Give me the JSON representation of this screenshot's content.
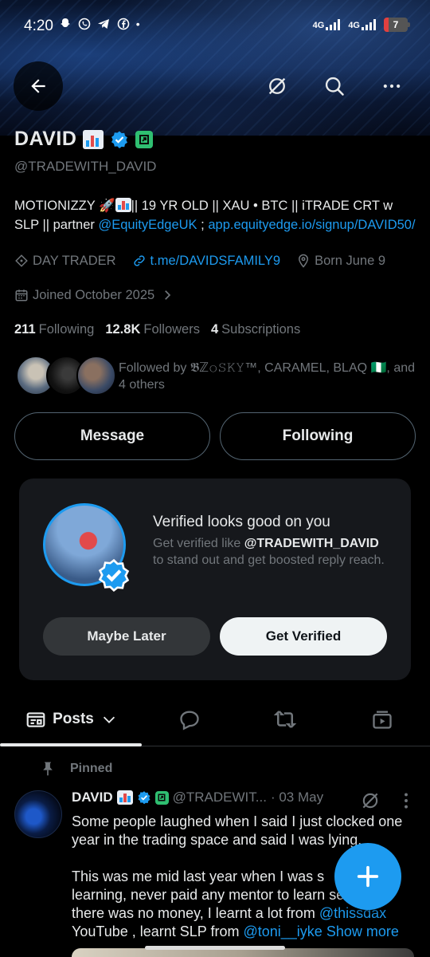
{
  "status_bar": {
    "time": "4:20",
    "notification_icons": "snapchat whatsapp telegram facebook •",
    "network_1": "4G",
    "network_2": "4G",
    "battery": "7"
  },
  "profile": {
    "display_name": "DAVID",
    "handle": "@TRADEWITH_DAVID",
    "bio_text": "MOTIONIZZY 🚀",
    "bio_text_2": "|| 19 YR OLD || XAU • BTC || iTRADE CRT w SLP || partner ",
    "bio_link_1": "@EquityEdgeUK",
    "bio_sep": " ; ",
    "bio_link_2": "app.equityedge.io/signup/DAVID50/",
    "category": "DAY TRADER",
    "website": "t.me/DAVIDSFAMILY9",
    "born": "Born June 9",
    "joined": "Joined October 2025",
    "following_count": "211",
    "following_label": "Following",
    "followers_count": "12.8K",
    "followers_label": "Followers",
    "subscriptions_count": "4",
    "subscriptions_label": "Subscriptions",
    "followed_by": "Followed by 𝕭ℤ𝚘𝚂𝙺𝚈™, CARAMEL, BLAQ 🇳🇬, and 4 others"
  },
  "actions": {
    "message": "Message",
    "following": "Following"
  },
  "verify_card": {
    "title": "Verified looks good on you",
    "desc_prefix": "Get verified like ",
    "desc_handle": "@TRADEWITH_DAVID",
    "desc_suffix": " to stand out and get boosted reply reach.",
    "maybe_later": "Maybe Later",
    "get_verified": "Get Verified"
  },
  "tabs": {
    "posts": "Posts"
  },
  "post": {
    "pinned": "Pinned",
    "name": "DAVID",
    "handle": "@TRADEWIT...",
    "date": "· 03 May",
    "para1": "Some people laughed when I said I just clocked one year in the trading space and said I was lying.",
    "para2_a": "This was me mid last year when I was s",
    "para2_b": "learning, never paid any mentor to learn",
    "para2_c": "se",
    "para2_d": "there was no money, I learnt a lot from ",
    "para2_link1": "@thissdax",
    "para2_e": "YouTube , learnt SLP from ",
    "para2_link2": "@toni__iyke",
    "show_more": "Show more"
  },
  "colors": {
    "accent": "#1d9bf0",
    "muted": "#71767b",
    "text": "#e7e9ea",
    "background": "#000000",
    "card": "#16181c"
  },
  "icons": [
    "back-arrow-icon",
    "grok-icon",
    "search-icon",
    "more-icon",
    "verified-badge-icon",
    "affiliate-badge-icon",
    "category-icon",
    "link-icon",
    "location-icon",
    "calendar-icon",
    "chevron-right-icon",
    "posts-tab-icon",
    "chevron-down-icon",
    "replies-tab-icon",
    "reposts-tab-icon",
    "media-tab-icon",
    "pin-icon",
    "compose-plus-icon"
  ]
}
